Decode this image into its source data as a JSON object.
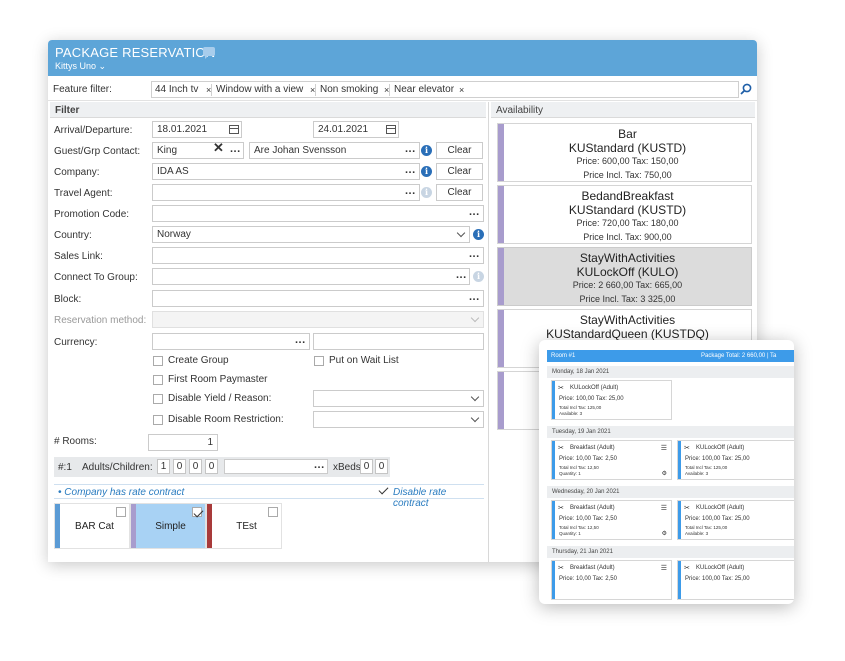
{
  "window": {
    "title": "PACKAGE RESERVATION",
    "subtitle": "Kittys Uno",
    "subtitle_chevron": "⌄"
  },
  "feature_filter": {
    "label": "Feature filter:",
    "chips": [
      "44 Inch tv",
      "Window with a view",
      "Non smoking",
      "Near elevator"
    ],
    "remove_glyph": "×"
  },
  "filter": {
    "header": "Filter",
    "arrival_label": "Arrival/Departure:",
    "arrival": "18.01.2021",
    "departure": "24.01.2021",
    "guest_label": "Guest/Grp Contact:",
    "guest": "King",
    "guest_clear_glyph": "✕",
    "contact": "Are Johan Svensson",
    "company_label": "Company:",
    "company": "IDA AS",
    "travel_agent_label": "Travel Agent:",
    "travel_agent": "",
    "promotion_label": "Promotion Code:",
    "promotion": "",
    "country_label": "Country:",
    "country": "Norway",
    "sales_link_label": "Sales Link:",
    "connect_label": "Connect To Group:",
    "block_label": "Block:",
    "reservation_method_label": "Reservation method:",
    "currency_label": "Currency:",
    "clear_label": "Clear",
    "dots": "...",
    "info_glyph": "i",
    "checkboxes": {
      "create_group": "Create Group",
      "put_on_wait_list": "Put on Wait List",
      "first_room_paymaster": "First Room Paymaster",
      "disable_yield": "Disable Yield / Reason:",
      "disable_room_restriction": "Disable Room Restriction:"
    },
    "rooms_label": "# Rooms:",
    "rooms": "1",
    "row_label": "#:1",
    "adults_children_label": "Adults/Children:",
    "adults_children": [
      "1",
      "0",
      "0",
      "0"
    ],
    "xbeds_label": "xBeds",
    "xbeds": [
      "0",
      "0"
    ],
    "company_rate_contract": "• Company has rate contract",
    "disable_rate_contract": "Disable rate contract"
  },
  "rate_tiles": [
    {
      "name": "BAR Cat",
      "color": "#5b9bd5",
      "selected": false
    },
    {
      "name": "Simple",
      "color": "#a89ccd",
      "selected": true
    },
    {
      "name": "TEst",
      "color": "#a83a3a",
      "selected": false
    }
  ],
  "availability": {
    "header": "Availability",
    "packages": [
      {
        "name": "Bar",
        "room": "KUStandard (KUSTD)",
        "price": "Price: 600,00 Tax: 150,00",
        "incl": "Price Incl. Tax: 750,00",
        "selected": false
      },
      {
        "name": "BedandBreakfast",
        "room": "KUStandard (KUSTD)",
        "price": "Price: 720,00 Tax: 180,00",
        "incl": "Price Incl. Tax: 900,00",
        "selected": false
      },
      {
        "name": "StayWithActivities",
        "room": "KULockOff (KULO)",
        "price": "Price: 2 660,00 Tax: 665,00",
        "incl": "Price Incl. Tax: 3 325,00",
        "selected": true
      },
      {
        "name": "StayWithActivities",
        "room": "KUStandardQueen (KUSTDQ)",
        "price": "",
        "incl": "",
        "selected": false
      }
    ]
  },
  "popup": {
    "room": "Room #1",
    "total": "Package Total: 2 660,00  |  Ta",
    "days": [
      {
        "date": "Monday, 18 Jan 2021",
        "cards": [
          {
            "name": "KULockOff (Adult)",
            "price": "Price: 100,00 Tax: 25,00",
            "total": "Total Incl Tax: 125,00",
            "qty": "Available: 3",
            "icon": "✂"
          }
        ]
      },
      {
        "date": "Tuesday, 19 Jan 2021",
        "cards": [
          {
            "name": "Breakfast (Adult)",
            "price": "Price: 10,00 Tax: 2,50",
            "total": "Total Incl Tax: 12,50",
            "qty": "Quantity: 1",
            "icon": "✂"
          },
          {
            "name": "KULockOff (Adult)",
            "price": "Price: 100,00 Tax: 25,00",
            "total": "Total Incl Tax: 125,00",
            "qty": "Available: 3",
            "icon": "✂"
          }
        ]
      },
      {
        "date": "Wednesday, 20 Jan 2021",
        "cards": [
          {
            "name": "Breakfast (Adult)",
            "price": "Price: 10,00 Tax: 2,50",
            "total": "Total Incl Tax: 12,50",
            "qty": "Quantity: 1",
            "icon": "✂"
          },
          {
            "name": "KULockOff (Adult)",
            "price": "Price: 100,00 Tax: 25,00",
            "total": "Total Incl Tax: 125,00",
            "qty": "Available: 3",
            "icon": "✂"
          }
        ]
      },
      {
        "date": "Thursday, 21 Jan 2021",
        "cards": [
          {
            "name": "Breakfast (Adult)",
            "price": "Price: 10,00 Tax: 2,50",
            "total": "",
            "qty": "",
            "icon": "✂"
          },
          {
            "name": "KULockOff (Adult)",
            "price": "Price: 100,00 Tax: 25,00",
            "total": "",
            "qty": "",
            "icon": "✂"
          }
        ]
      }
    ],
    "menu_glyph": "☰",
    "gear_glyph": "⚙"
  }
}
